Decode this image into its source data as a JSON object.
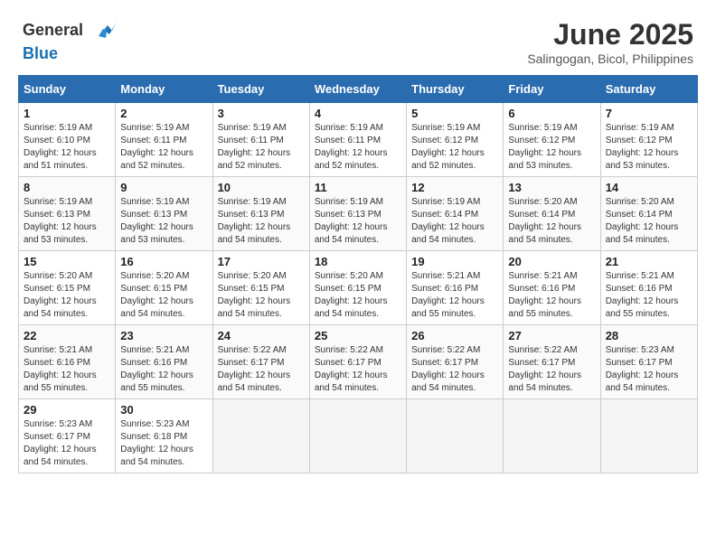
{
  "logo": {
    "general": "General",
    "blue": "Blue"
  },
  "title": "June 2025",
  "subtitle": "Salingogan, Bicol, Philippines",
  "days_header": [
    "Sunday",
    "Monday",
    "Tuesday",
    "Wednesday",
    "Thursday",
    "Friday",
    "Saturday"
  ],
  "weeks": [
    [
      {
        "day": "1",
        "sunrise": "5:19 AM",
        "sunset": "6:10 PM",
        "daylight": "12 hours and 51 minutes."
      },
      {
        "day": "2",
        "sunrise": "5:19 AM",
        "sunset": "6:11 PM",
        "daylight": "12 hours and 52 minutes."
      },
      {
        "day": "3",
        "sunrise": "5:19 AM",
        "sunset": "6:11 PM",
        "daylight": "12 hours and 52 minutes."
      },
      {
        "day": "4",
        "sunrise": "5:19 AM",
        "sunset": "6:11 PM",
        "daylight": "12 hours and 52 minutes."
      },
      {
        "day": "5",
        "sunrise": "5:19 AM",
        "sunset": "6:12 PM",
        "daylight": "12 hours and 52 minutes."
      },
      {
        "day": "6",
        "sunrise": "5:19 AM",
        "sunset": "6:12 PM",
        "daylight": "12 hours and 53 minutes."
      },
      {
        "day": "7",
        "sunrise": "5:19 AM",
        "sunset": "6:12 PM",
        "daylight": "12 hours and 53 minutes."
      }
    ],
    [
      {
        "day": "8",
        "sunrise": "5:19 AM",
        "sunset": "6:13 PM",
        "daylight": "12 hours and 53 minutes."
      },
      {
        "day": "9",
        "sunrise": "5:19 AM",
        "sunset": "6:13 PM",
        "daylight": "12 hours and 53 minutes."
      },
      {
        "day": "10",
        "sunrise": "5:19 AM",
        "sunset": "6:13 PM",
        "daylight": "12 hours and 54 minutes."
      },
      {
        "day": "11",
        "sunrise": "5:19 AM",
        "sunset": "6:13 PM",
        "daylight": "12 hours and 54 minutes."
      },
      {
        "day": "12",
        "sunrise": "5:19 AM",
        "sunset": "6:14 PM",
        "daylight": "12 hours and 54 minutes."
      },
      {
        "day": "13",
        "sunrise": "5:20 AM",
        "sunset": "6:14 PM",
        "daylight": "12 hours and 54 minutes."
      },
      {
        "day": "14",
        "sunrise": "5:20 AM",
        "sunset": "6:14 PM",
        "daylight": "12 hours and 54 minutes."
      }
    ],
    [
      {
        "day": "15",
        "sunrise": "5:20 AM",
        "sunset": "6:15 PM",
        "daylight": "12 hours and 54 minutes."
      },
      {
        "day": "16",
        "sunrise": "5:20 AM",
        "sunset": "6:15 PM",
        "daylight": "12 hours and 54 minutes."
      },
      {
        "day": "17",
        "sunrise": "5:20 AM",
        "sunset": "6:15 PM",
        "daylight": "12 hours and 54 minutes."
      },
      {
        "day": "18",
        "sunrise": "5:20 AM",
        "sunset": "6:15 PM",
        "daylight": "12 hours and 54 minutes."
      },
      {
        "day": "19",
        "sunrise": "5:21 AM",
        "sunset": "6:16 PM",
        "daylight": "12 hours and 55 minutes."
      },
      {
        "day": "20",
        "sunrise": "5:21 AM",
        "sunset": "6:16 PM",
        "daylight": "12 hours and 55 minutes."
      },
      {
        "day": "21",
        "sunrise": "5:21 AM",
        "sunset": "6:16 PM",
        "daylight": "12 hours and 55 minutes."
      }
    ],
    [
      {
        "day": "22",
        "sunrise": "5:21 AM",
        "sunset": "6:16 PM",
        "daylight": "12 hours and 55 minutes."
      },
      {
        "day": "23",
        "sunrise": "5:21 AM",
        "sunset": "6:16 PM",
        "daylight": "12 hours and 55 minutes."
      },
      {
        "day": "24",
        "sunrise": "5:22 AM",
        "sunset": "6:17 PM",
        "daylight": "12 hours and 54 minutes."
      },
      {
        "day": "25",
        "sunrise": "5:22 AM",
        "sunset": "6:17 PM",
        "daylight": "12 hours and 54 minutes."
      },
      {
        "day": "26",
        "sunrise": "5:22 AM",
        "sunset": "6:17 PM",
        "daylight": "12 hours and 54 minutes."
      },
      {
        "day": "27",
        "sunrise": "5:22 AM",
        "sunset": "6:17 PM",
        "daylight": "12 hours and 54 minutes."
      },
      {
        "day": "28",
        "sunrise": "5:23 AM",
        "sunset": "6:17 PM",
        "daylight": "12 hours and 54 minutes."
      }
    ],
    [
      {
        "day": "29",
        "sunrise": "5:23 AM",
        "sunset": "6:17 PM",
        "daylight": "12 hours and 54 minutes."
      },
      {
        "day": "30",
        "sunrise": "5:23 AM",
        "sunset": "6:18 PM",
        "daylight": "12 hours and 54 minutes."
      },
      null,
      null,
      null,
      null,
      null
    ]
  ],
  "labels": {
    "sunrise": "Sunrise: ",
    "sunset": "Sunset: ",
    "daylight": "Daylight hours"
  }
}
